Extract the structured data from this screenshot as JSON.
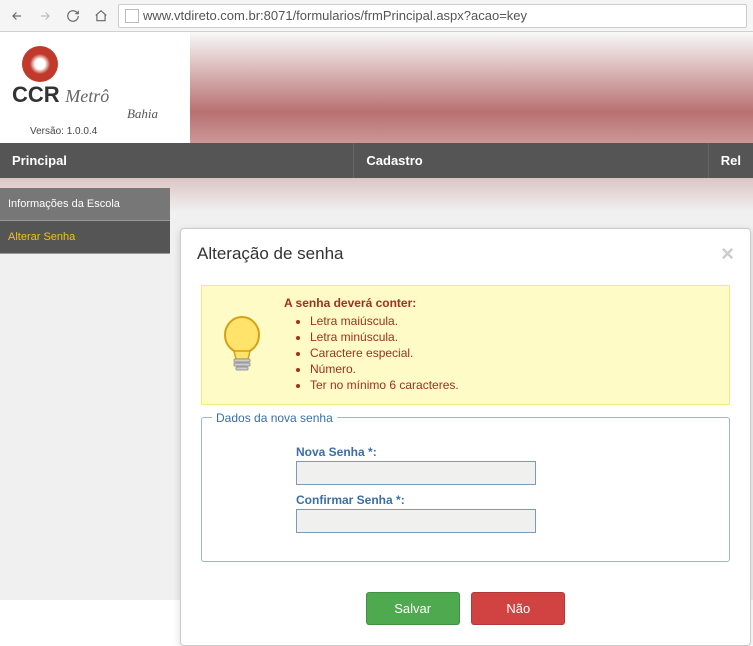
{
  "browser": {
    "url": "www.vtdireto.com.br:8071/formularios/frmPrincipal.aspx?acao=key"
  },
  "logo": {
    "brand_ccr": "CCR",
    "brand_metro": "Metrô",
    "brand_bahia": "Bahia",
    "version": "Versão: 1.0.0.4"
  },
  "topnav": {
    "principal": "Principal",
    "cadastro": "Cadastro",
    "rel": "Rel"
  },
  "sidebar": {
    "info_escola": "Informações da Escola",
    "alterar_senha": "Alterar Senha"
  },
  "modal": {
    "title": "Alteração de senha",
    "info_title": "A senha deverá conter:",
    "rules": [
      "Letra maiúscula.",
      "Letra minúscula.",
      "Caractere especial.",
      "Número.",
      "Ter no mínimo 6 caracteres."
    ],
    "fieldset_legend": "Dados da nova senha",
    "nova_senha_label": "Nova Senha *:",
    "confirmar_senha_label": "Confirmar Senha *:",
    "btn_salvar": "Salvar",
    "btn_nao": "Não"
  }
}
